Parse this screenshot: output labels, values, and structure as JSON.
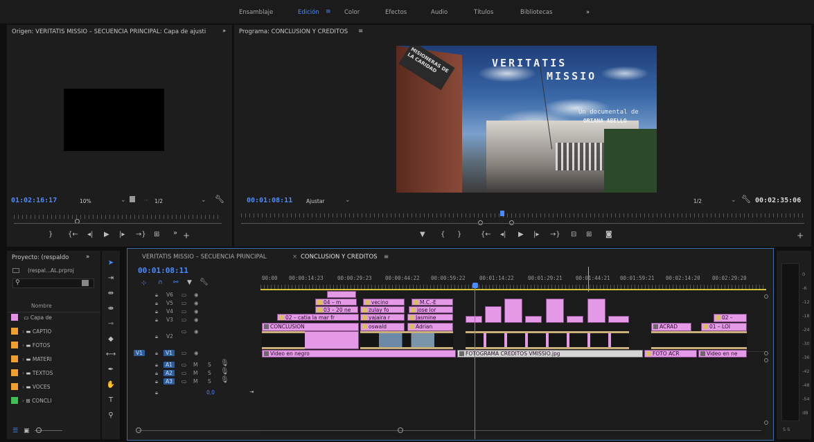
{
  "workspaces": [
    "Ensamblaje",
    "Edición",
    "Color",
    "Efectos",
    "Audio",
    "Títulos",
    "Bibliotecas"
  ],
  "workspace_more": "»",
  "source": {
    "title": "Origen: VERITATIS MISSIO – SECUENCIA PRINCIPAL: Capa de ajusti",
    "more": "»",
    "timecode": "01:02:16:17",
    "zoom": "10%",
    "resolution": "1/2"
  },
  "program": {
    "title": "Programa: CONCLUSION Y CREDITOS",
    "menu": "≡",
    "timecode": "00:01:08:11",
    "fit": "Ajustar",
    "resolution": "1/2",
    "duration": "00:02:35:06",
    "frame": {
      "title_line1": "VERITATIS",
      "title_line2": "MISSIO",
      "subtitle": "Un documental de",
      "author": "ORIANA ABELLO",
      "sign": "MISIONERAS DE LA CARIDAD"
    }
  },
  "project": {
    "title": "Proyecto: (respaldo",
    "more": "»",
    "file": "(respal...AL.prproj",
    "column": "Nombre",
    "items": [
      {
        "name": "Capa de",
        "color": "#e78fe6",
        "icon": "layer-icon"
      },
      {
        "name": "CAPTIO",
        "color": "#f0a030",
        "icon": "folder-icon"
      },
      {
        "name": "FOTOS",
        "color": "#f0a030",
        "icon": "folder-icon"
      },
      {
        "name": "MATERI",
        "color": "#f0a030",
        "icon": "folder-icon"
      },
      {
        "name": "TEXTOS",
        "color": "#f0a030",
        "icon": "folder-icon"
      },
      {
        "name": "VOCES",
        "color": "#f0a030",
        "icon": "folder-icon"
      },
      {
        "name": "CONCLI",
        "color": "#3fbf4f",
        "icon": "sequence-icon"
      }
    ]
  },
  "timeline": {
    "tab1": "VERITATIS MISSIO – SECUENCIA PRINCIPAL",
    "tab2": "CONCLUSION Y CREDITOS",
    "tab2_close": "×",
    "menu": "≡",
    "timecode": "00:01:08:11",
    "ruler": [
      "00:00",
      "00:00:14:23",
      "00:00:29:23",
      "00:00:44:22",
      "00:00:59:22",
      "00:01:14:22",
      "00:01:29:21",
      "00:01:44:21",
      "00:01:59:21",
      "00:02:14:20",
      "00:02:29:20"
    ],
    "tracks": {
      "video": [
        "V6",
        "V5",
        "V4",
        "V3",
        "V2",
        "V1"
      ],
      "audio": [
        "A1",
        "A2",
        "A3"
      ],
      "source_v": "V1",
      "volume": "0,0",
      "m": "M",
      "s": "S"
    },
    "clips": {
      "v6a": "04 – m",
      "v6b": "vecino",
      "v6c": "M.C.-E",
      "v5a": "03 – 20 ne",
      "v5b": "zulay fo",
      "v5c": "jose lor",
      "v4a": "02 – catia la mar fr",
      "v4b": "yajaira r",
      "v4c": "Jasmine",
      "v4d": "02 –",
      "v3a": "CONCLUSION",
      "v3b": "oswald",
      "v3c": "Adrian",
      "v3d": "ACRAD",
      "v3e": "01 – LOI",
      "v1a": "Video en negro",
      "v1b": "FOTOGRAMA CREDITOS VMISSIO.jpg",
      "v1c": "FOTO ACR",
      "v1d": "Video en ne"
    }
  },
  "meter": [
    "0",
    "-6",
    "-12",
    "-18",
    "-24",
    "-30",
    "-36",
    "-42",
    "-48",
    "-54",
    "dB"
  ],
  "meter_footer": "S S",
  "colors": {
    "accent": "#4a8cff",
    "clip": "#e49ae6",
    "background": "#1d1d1d"
  }
}
